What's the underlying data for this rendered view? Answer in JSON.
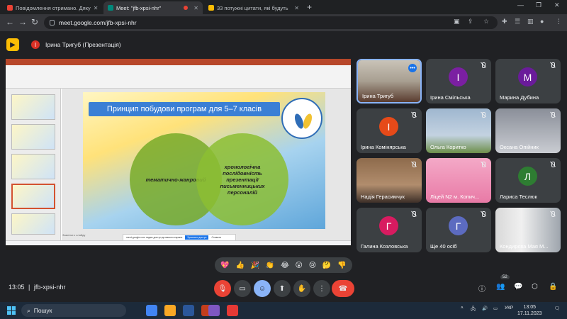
{
  "browser": {
    "tabs": [
      {
        "label": "Повідомлення отримано. Дяку",
        "active": false
      },
      {
        "label": "Meet: \"jfb-xpsi-nhr\"",
        "active": true
      },
      {
        "label": "33 потужні цитати, які будуть",
        "active": false
      }
    ],
    "url": "meet.google.com/jfb-xpsi-nhr"
  },
  "meet": {
    "presenter_label": "Ірина Тригуб (Презентація)",
    "presenter_initial": "І",
    "meeting_time": "13:05",
    "meeting_code": "jfb-xpsi-nhr",
    "participants_badge": "52"
  },
  "slide": {
    "title": "Принцип побудови програм для 5–7 класів",
    "left_circle": "тематично-жанровий",
    "right_circle": "хронологічна послідовність презентації письменницьких персоналій",
    "notes_placeholder": "Заметки к слайду",
    "share_prompt": "meet.google.com надає доступ до вашого екрана",
    "share_stop": "Зупинити доступ",
    "share_hide": "Сховати"
  },
  "participants": [
    {
      "name": "Ірина Тригуб",
      "initial": "",
      "color": "#3c4043",
      "photo": true,
      "active": true
    },
    {
      "name": "Ірина Смільська",
      "initial": "І",
      "color": "#7b1fa2",
      "photo": false,
      "active": false
    },
    {
      "name": "Марина Дубина",
      "initial": "М",
      "color": "#6a1b9a",
      "photo": false,
      "active": false
    },
    {
      "name": "Ірина Комінярська",
      "initial": "І",
      "color": "#e64a19",
      "photo": false,
      "active": false
    },
    {
      "name": "Ольга Коритко",
      "initial": "",
      "color": "#3c4043",
      "photo": true,
      "active": false
    },
    {
      "name": "Оксана Опійник",
      "initial": "",
      "color": "#3c4043",
      "photo": true,
      "active": false
    },
    {
      "name": "Надія Герасимчук",
      "initial": "",
      "color": "#3c4043",
      "photo": true,
      "active": false
    },
    {
      "name": "Ліцей N2 м. Копич...",
      "initial": "",
      "color": "#3c4043",
      "photo": true,
      "active": false
    },
    {
      "name": "Лариса Теслюк",
      "initial": "Л",
      "color": "#2e7d32",
      "photo": false,
      "active": false
    },
    {
      "name": "Галина Козловська",
      "initial": "Г",
      "color": "#d81b60",
      "photo": false,
      "active": false
    },
    {
      "name": "Ще 40 осіб",
      "initial": "Г",
      "color": "#5c6bc0",
      "photo": false,
      "active": false
    },
    {
      "name": "Кондирєва Мая М...",
      "initial": "",
      "color": "#3c4043",
      "photo": true,
      "active": false
    }
  ],
  "reactions": [
    "💖",
    "👍",
    "🎉",
    "👏",
    "😂",
    "😮",
    "😢",
    "🤔",
    "👎"
  ],
  "taskbar": {
    "search_placeholder": "Пошук",
    "keyboard_lang": "УКР",
    "clock_time": "13:05",
    "clock_date": "17.11.2023"
  }
}
